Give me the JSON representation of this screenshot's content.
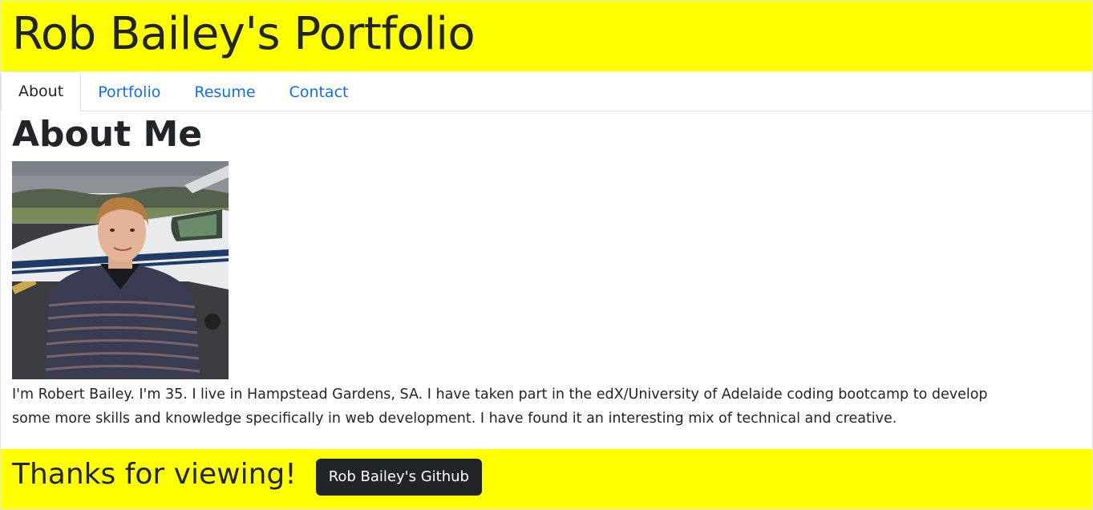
{
  "header": {
    "title": "Rob Bailey's Portfolio"
  },
  "nav": {
    "tabs": [
      {
        "label": "About",
        "active": true
      },
      {
        "label": "Portfolio",
        "active": false
      },
      {
        "label": "Resume",
        "active": false
      },
      {
        "label": "Contact",
        "active": false
      }
    ]
  },
  "main": {
    "heading": "About Me",
    "bio": "I'm Robert Bailey. I'm 35. I live in Hampstead Gardens, SA. I have taken part in the edX/University of Adelaide coding bootcamp to develop some more skills and knowledge specifically in web development. I have found it an interesting mix of technical and creative."
  },
  "footer": {
    "message": "Thanks for viewing!",
    "github_button": "Rob Bailey's Github"
  },
  "colors": {
    "banner": "#ffff00",
    "link": "#0d6efd",
    "text": "#212529",
    "button_bg": "#212529"
  }
}
